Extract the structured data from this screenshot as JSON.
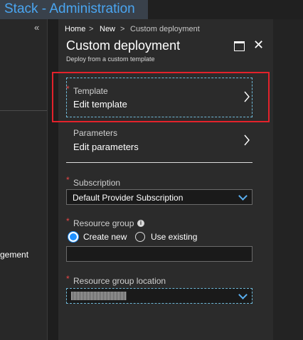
{
  "app": {
    "title": "Stack - Administration"
  },
  "left_pane": {
    "collapse_glyph": "«",
    "partial_item": "gement"
  },
  "breadcrumb": {
    "home": "Home",
    "new": "New",
    "current": "Custom deployment",
    "separator": ">"
  },
  "blade": {
    "title": "Custom deployment",
    "subtitle": "Deploy from a custom template",
    "close_glyph": "✕",
    "template": {
      "label": "Template",
      "value": "Edit template",
      "required": "*"
    },
    "parameters": {
      "label": "Parameters",
      "value": "Edit parameters"
    },
    "subscription": {
      "label": "Subscription",
      "value": "Default Provider Subscription",
      "required": "*"
    },
    "resource_group": {
      "label": "Resource group",
      "required": "*",
      "info_glyph": "i",
      "options": [
        {
          "label": "Create new",
          "selected": true
        },
        {
          "label": "Use existing",
          "selected": false
        }
      ],
      "value": ""
    },
    "location": {
      "label": "Resource group location",
      "required": "*"
    }
  },
  "colors": {
    "accent": "#1e90ff",
    "title_blue": "#4aa5f0",
    "required": "#e84646",
    "highlight": "#e3222b"
  },
  "icons": [
    "collapse-icon",
    "maximize-icon",
    "close-icon",
    "chevron-right-icon",
    "chevron-down-icon",
    "info-icon"
  ]
}
